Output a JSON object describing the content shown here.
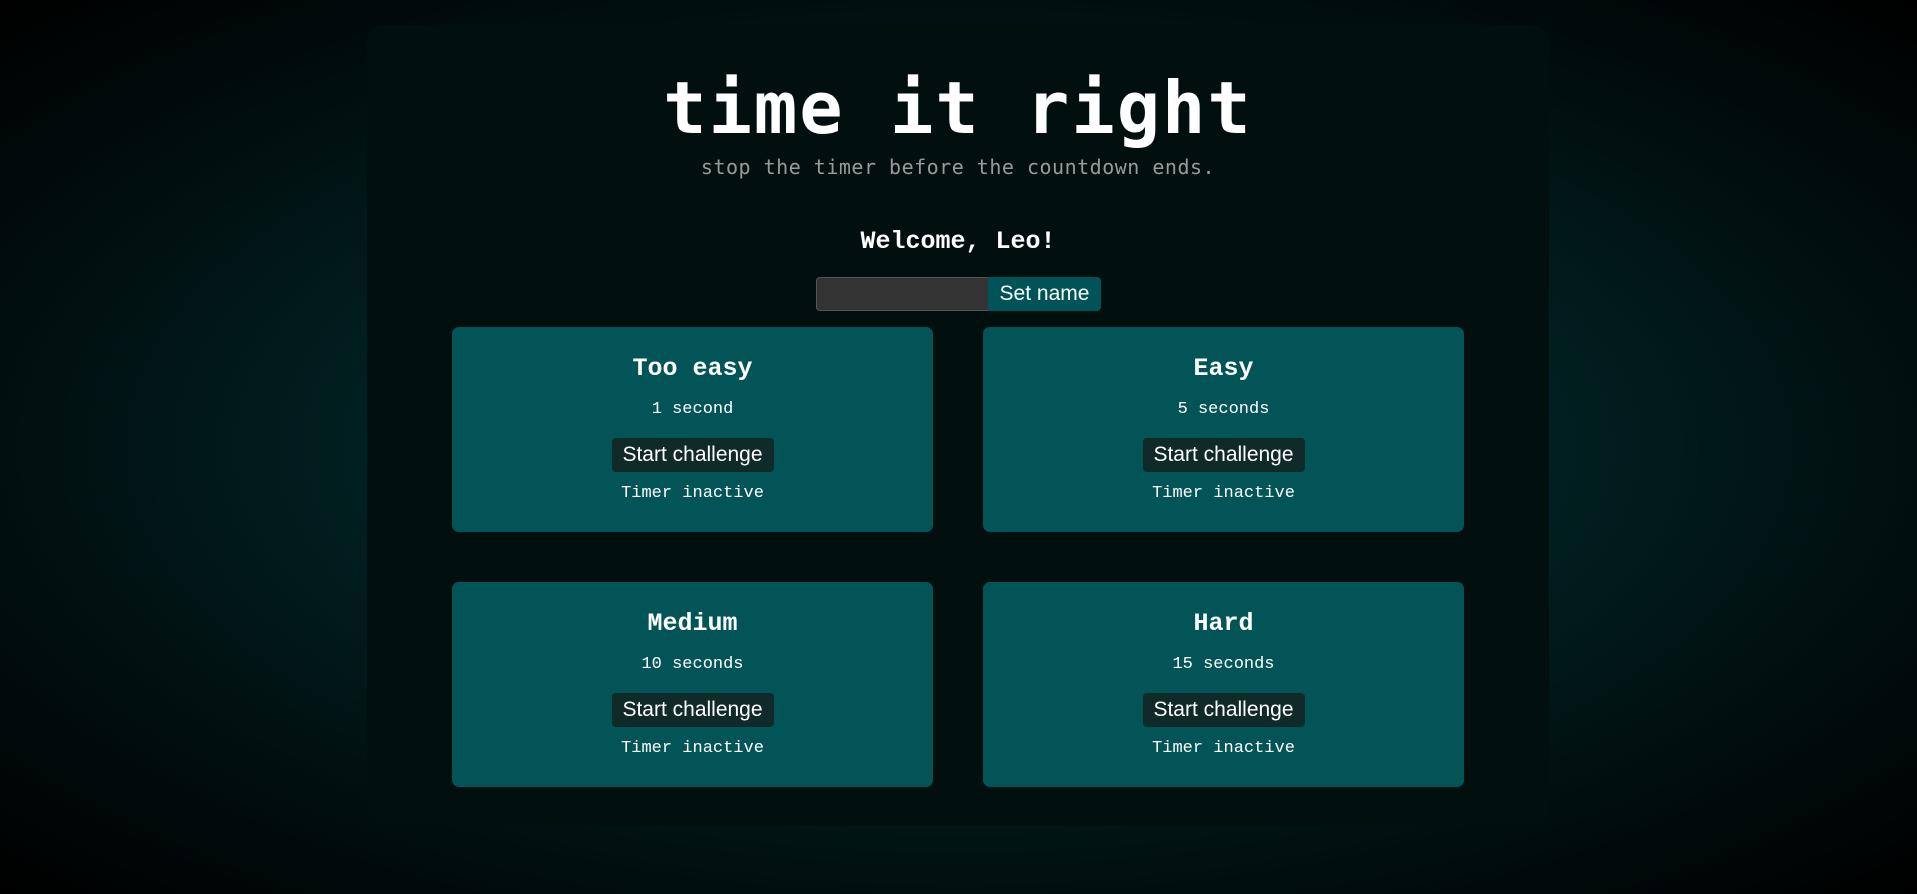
{
  "header": {
    "title": "time it right",
    "subtitle": "stop the timer before the countdown ends."
  },
  "welcome": {
    "text": "Welcome, Leo!"
  },
  "name_form": {
    "input_value": "",
    "button_label": "Set name"
  },
  "challenges": [
    {
      "title": "Too easy",
      "duration": "1 second",
      "button_label": "Start challenge",
      "status": "Timer inactive"
    },
    {
      "title": "Easy",
      "duration": "5 seconds",
      "button_label": "Start challenge",
      "status": "Timer inactive"
    },
    {
      "title": "Medium",
      "duration": "10 seconds",
      "button_label": "Start challenge",
      "status": "Timer inactive"
    },
    {
      "title": "Hard",
      "duration": "15 seconds",
      "button_label": "Start challenge",
      "status": "Timer inactive"
    }
  ],
  "colors": {
    "panel_background": "#020f0f",
    "card_background": "#025457",
    "accent_button": "#005457",
    "card_button": "#102a2a",
    "subtitle_text": "#9a9a9a"
  }
}
